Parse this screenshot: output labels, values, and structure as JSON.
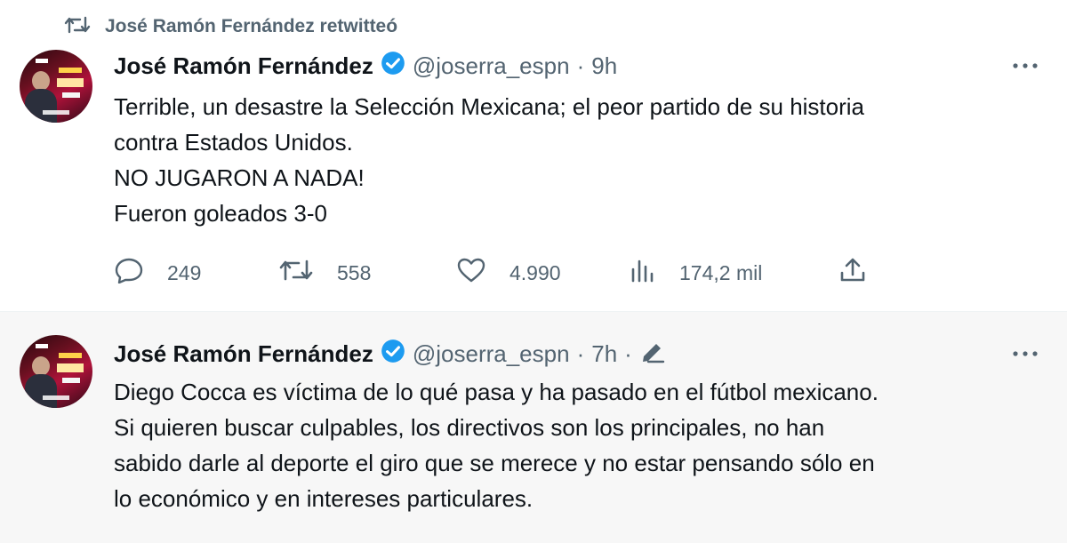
{
  "retweet": {
    "label": "José Ramón Fernández retwitteó"
  },
  "tweet1": {
    "name": "José Ramón Fernández",
    "handle": "@joserra_espn",
    "separator": "·",
    "time": "9h",
    "lines": [
      "Terrible, un desastre la Selección Mexicana; el peor partido de su historia",
      "contra Estados Unidos.",
      "NO JUGARON A NADA!",
      "Fueron goleados 3-0"
    ],
    "replies": "249",
    "retweets": "558",
    "likes": "4.990",
    "views": "174,2 mil"
  },
  "tweet2": {
    "name": "José Ramón Fernández",
    "handle": "@joserra_espn",
    "separator": "·",
    "time": "7h",
    "separator2": "·",
    "lines": [
      "Diego Cocca es víctima de lo qué pasa y ha pasado en el fútbol mexicano.",
      "Si quieren buscar culpables, los directivos son los principales, no han",
      "sabido darle al deporte el giro que se merece y no estar pensando sólo en",
      "lo económico y en intereses particulares."
    ]
  },
  "colors": {
    "secondary_text": "#536471",
    "verified": "#1d9bf0",
    "primary_text": "#0f1419"
  }
}
